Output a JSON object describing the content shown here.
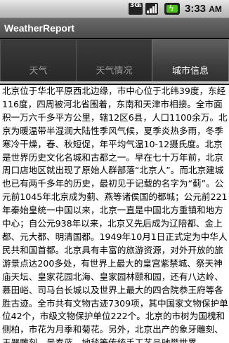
{
  "status_bar": {
    "network_type": "3G",
    "signal_icon": "signal-bars-icon",
    "battery_icon": "battery-charging-icon",
    "time": "3:33",
    "time_suffix": "AM",
    "battery_color": "#4fc31a"
  },
  "app": {
    "title": "WeatherReport"
  },
  "tabs": [
    {
      "label": "天气",
      "active": false
    },
    {
      "label": "天气情况",
      "active": false
    },
    {
      "label": "城市信息",
      "active": true
    }
  ],
  "content": {
    "text": "北京位于华北平原西北边缘，市中心位于北纬39度，东经116度，四周被河北省围着，东南和天津市相接。全市面积一万六千多平方公里，辖12区6县，人口1100余万。北京为暖温带半湿润大陆性季风气候，夏季炎热多雨，冬季寒冷干燥，春、秋短促，年平均气温10-12摄氏度。北京是世界历史文化名城和古都之一。早在七十万年前，北京周口店地区就出现了原始人群部落“北京人”。而北京建城也已有两千多年的历史，最初见于记载的名字为“蓟”。公元前1045年北京成为蓟、燕等诸侯国的都城；公元前221年秦始皇统一中国以来，北京一直是中国北方重镇和地方中心；自公元938年以来，北京又先后成为辽陪都、金上都、元大都、明清国都。1949年10月1日正式定为中华人民共和国首都。北京具有丰富的旅游资源，对外开放的旅游景点达200多处，有世界上最大的皇宫紫禁城、祭天神庙天坛、皇家花园北海、皇家园林颐和园，还有八达岭、慕田峪、司马台长城以及世界上最大的四合院恭王府等各胜古迹。全市共有文物古迹7309项，其中国家文物保护单位42个，市级文物保护单位222个。北京的市树为国槐和侧柏，市花为月季和菊花。另外，北京出产的象牙雕刻、玉器雕刻、景泰蓝、地毯等传统手工艺品驰誉世界。"
  }
}
